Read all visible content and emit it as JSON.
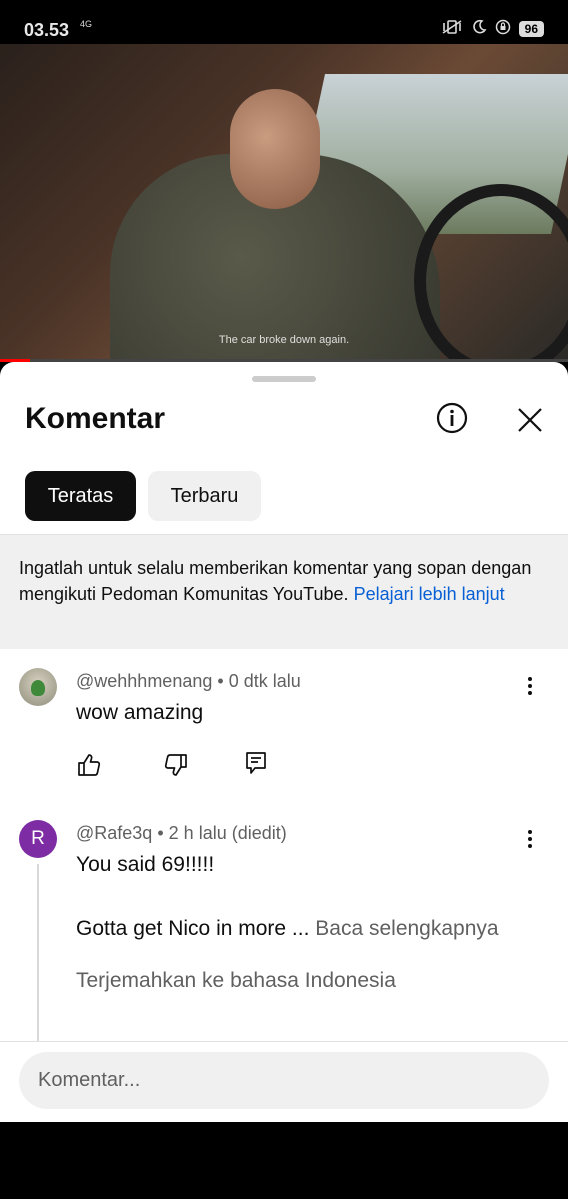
{
  "status_bar": {
    "time": "03.53",
    "network": "4G",
    "battery": "96"
  },
  "video": {
    "caption": "The car broke down again."
  },
  "comments_panel": {
    "title": "Komentar",
    "tabs": [
      {
        "label": "Teratas",
        "selected": true
      },
      {
        "label": "Terbaru",
        "selected": false
      }
    ],
    "notice": {
      "text": "Ingatlah untuk selalu memberikan komentar yang sopan dengan mengikuti Pedoman Komunitas YouTube.",
      "link": "Pelajari lebih lanjut"
    },
    "comments": [
      {
        "author": "@wehhhmenang",
        "time": "0 dtk lalu",
        "text": "wow amazing"
      },
      {
        "author": "@Rafe3q",
        "time": "2 h lalu (diedit)",
        "avatar_letter": "R",
        "line1": "You said 69!!!!!",
        "line2": "Gotta get Nico in more ...",
        "read_more": "Baca selengkapnya",
        "translate": "Terjemahkan ke bahasa Indonesia"
      }
    ],
    "input_placeholder": "Komentar..."
  },
  "colors": {
    "link": "#065fd4",
    "chip_selected_bg": "#0f0f0f",
    "avatar_r": "#7d2ca3",
    "progress": "#ff0000"
  }
}
